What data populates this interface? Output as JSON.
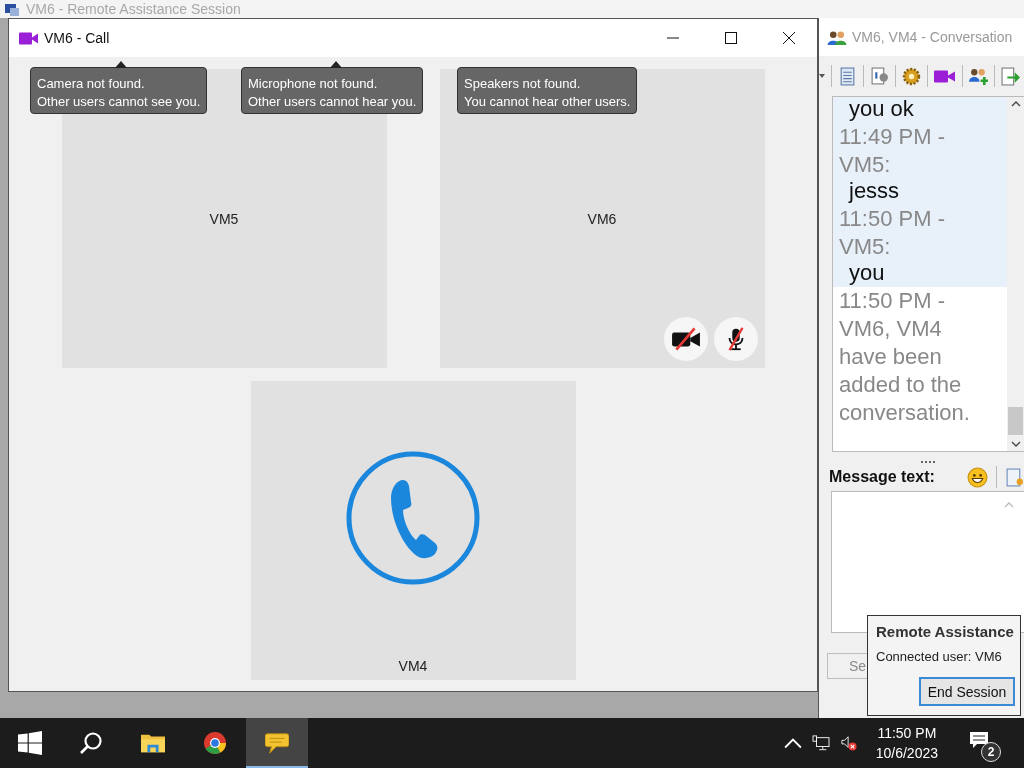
{
  "background_window": {
    "title": "VM6 - Remote Assistance Session"
  },
  "call_window": {
    "title": "VM6 - Call",
    "tooltips": [
      {
        "line1": "Camera not found.",
        "line2": "Other users cannot see you."
      },
      {
        "line1": "Microphone not found.",
        "line2": "Other users cannot hear you."
      },
      {
        "line1": "Speakers not found.",
        "line2": "You cannot hear other users."
      }
    ],
    "participants": [
      {
        "name": "VM5",
        "kind": "remote"
      },
      {
        "name": "VM6",
        "kind": "self",
        "camera_off": true,
        "mic_off": true
      },
      {
        "name": "VM4",
        "kind": "ringing"
      }
    ]
  },
  "conversation_window": {
    "title": "VM6, VM4 - Conversation",
    "toolbar": [
      {
        "kind": "log"
      },
      {
        "kind": "info"
      },
      {
        "kind": "settings"
      },
      {
        "kind": "video"
      },
      {
        "kind": "add-user"
      },
      {
        "kind": "exit"
      }
    ],
    "log": [
      {
        "kind": "message",
        "text": "you ok"
      },
      {
        "kind": "header",
        "text": "11:49 PM - VM5:"
      },
      {
        "kind": "message",
        "text": "jesss"
      },
      {
        "kind": "header",
        "text": "11:50 PM - VM5:"
      },
      {
        "kind": "message",
        "text": "you"
      },
      {
        "kind": "system",
        "text": "11:50 PM - VM6, VM4 have been added to the conversation."
      }
    ],
    "message_label": "Message text:",
    "buttons": [
      {
        "label": "Se",
        "disabled": true
      }
    ]
  },
  "notification": {
    "title": "Remote Assistance",
    "text": "Connected user: VM6",
    "button": "End Session"
  },
  "taskbar": {
    "items": [
      {
        "kind": "start",
        "selected": false
      },
      {
        "kind": "search",
        "selected": false
      },
      {
        "kind": "folder",
        "selected": false
      },
      {
        "kind": "browser",
        "selected": false
      },
      {
        "kind": "chat",
        "selected": true
      }
    ],
    "time": "11:50 PM",
    "date": "10/6/2023",
    "notifications": "2"
  }
}
